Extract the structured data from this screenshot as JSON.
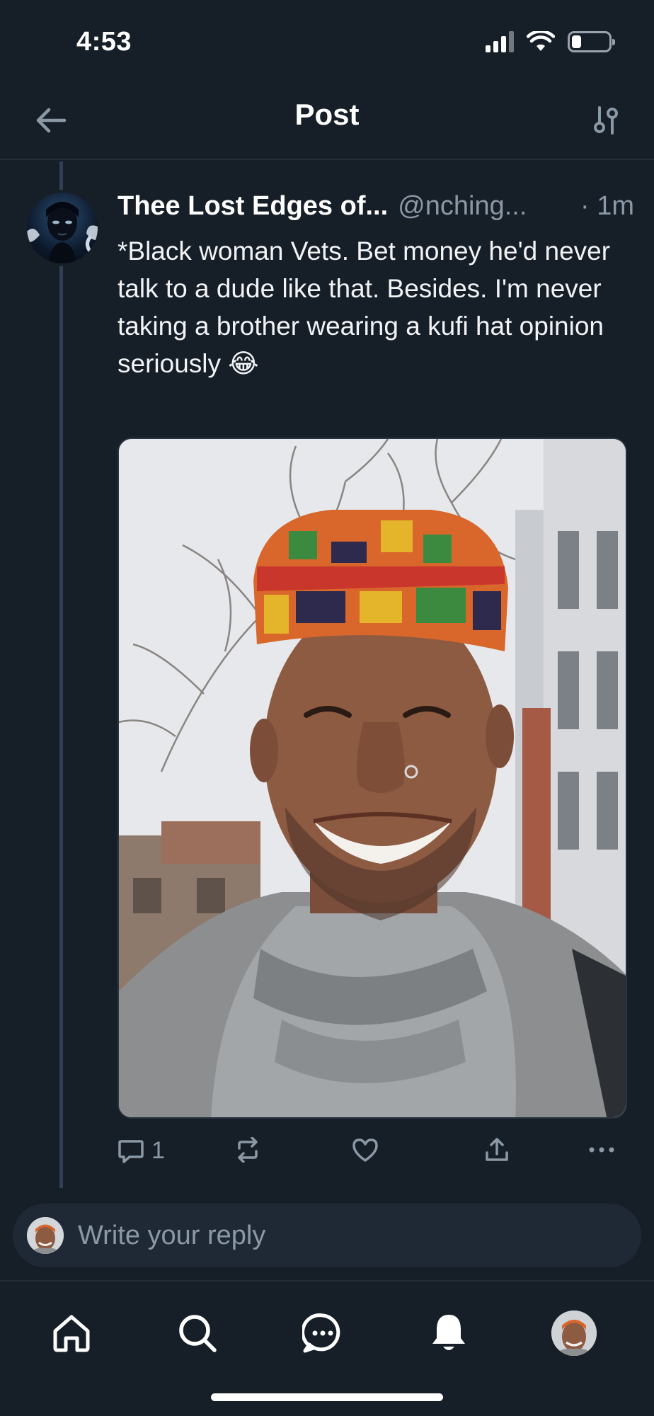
{
  "status_bar": {
    "time": "4:53",
    "battery_level": 0.25
  },
  "header": {
    "title": "Post"
  },
  "post": {
    "author": {
      "display_name": "Thee Lost Edges of...",
      "handle": "@nching...",
      "time": "· 1m"
    },
    "text": "*Black woman Vets. Bet money he'd never talk to a dude like that. Besides. I'm never taking a brother wearing a kufi hat opinion seriously 😂",
    "image": {
      "subject": "selfie of smiling man in colorful kufi hat and gray scarf"
    },
    "actions": {
      "reply_count": "1"
    }
  },
  "reply": {
    "placeholder": "Write your reply"
  },
  "icons": {
    "back": "arrow-left-icon",
    "filter": "sliders-icon",
    "reply": "comment-icon",
    "repost": "repost-icon",
    "like": "heart-icon",
    "share": "share-icon",
    "more": "more-icon",
    "home": "home-icon",
    "search": "search-icon",
    "chat": "chat-icon",
    "notifications": "bell-icon"
  },
  "colors": {
    "background": "#161e28",
    "text": "#f1f3f5",
    "muted": "#8b98a5",
    "thread_line": "#2f4055"
  }
}
